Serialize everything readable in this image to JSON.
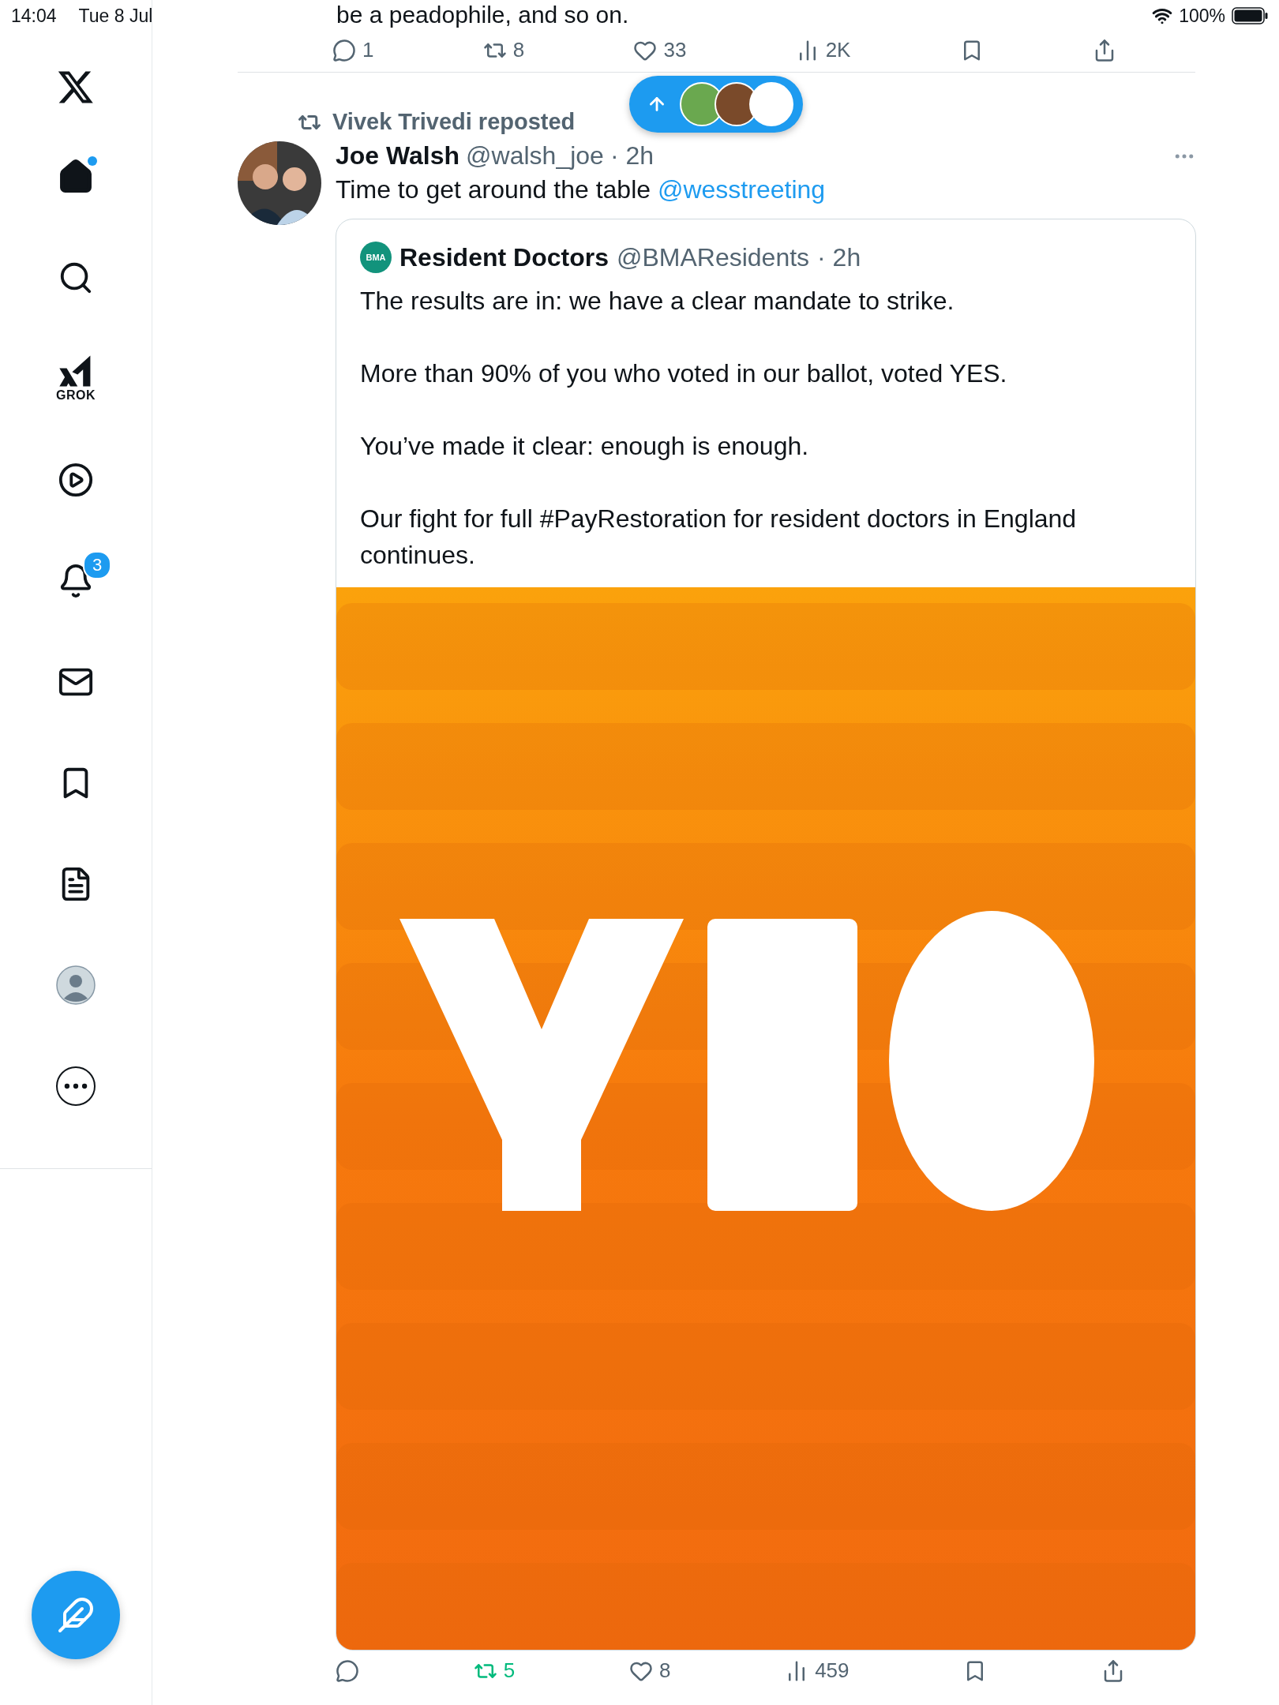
{
  "status_bar": {
    "time": "14:04",
    "date": "Tue 8 Jul",
    "battery": "100%"
  },
  "sidebar": {
    "items": [
      {
        "kind": "home",
        "selected": true,
        "dot": true
      },
      {
        "kind": "search",
        "selected": false
      },
      {
        "kind": "grok",
        "selected": false,
        "label": "GROK"
      },
      {
        "kind": "video",
        "selected": false
      },
      {
        "kind": "notifications",
        "selected": false,
        "badge": "3"
      },
      {
        "kind": "messages",
        "selected": false
      },
      {
        "kind": "bookmarks",
        "selected": false
      },
      {
        "kind": "articles",
        "selected": false
      },
      {
        "kind": "profile",
        "selected": false
      },
      {
        "kind": "more",
        "selected": false
      }
    ]
  },
  "previous_post": {
    "text": "be a peadophile, and so on.",
    "actions": [
      {
        "kind": "reply",
        "count": "1",
        "active": false
      },
      {
        "kind": "repost",
        "count": "8",
        "active": false
      },
      {
        "kind": "like",
        "count": "33",
        "active": false
      },
      {
        "kind": "views",
        "count": "2K",
        "active": false
      },
      {
        "kind": "bookmark",
        "active": false
      },
      {
        "kind": "share",
        "active": false
      }
    ]
  },
  "new_posts_pill": {
    "avatars": [
      {
        "color": "#6aa84f"
      },
      {
        "color": "#7a4a2a"
      },
      {
        "color": "#ffffff"
      }
    ]
  },
  "post": {
    "repost_by": "Vivek Trivedi reposted",
    "name": "Joe Walsh",
    "handle": "@walsh_joe",
    "time": "· 2h",
    "text": "Time to get around the table ",
    "mention": "@wesstreeting",
    "quote": {
      "name": "Resident Doctors",
      "handle": "@BMAResidents",
      "time": "· 2h",
      "logo": "BMA",
      "paragraphs": [
        "The results are in: we have a clear mandate to strike.",
        "More than 90% of you who voted in our ballot, voted YES.",
        "You’ve made it clear: enough is enough.",
        "Our fight for full #PayRestoration for resident doctors in England continues."
      ]
    },
    "actions": [
      {
        "kind": "reply",
        "active": false
      },
      {
        "kind": "repost",
        "count": "5",
        "active": true
      },
      {
        "kind": "like",
        "count": "8",
        "active": false
      },
      {
        "kind": "views",
        "count": "459",
        "active": false
      },
      {
        "kind": "bookmark",
        "active": false
      },
      {
        "kind": "share",
        "active": false
      }
    ]
  }
}
